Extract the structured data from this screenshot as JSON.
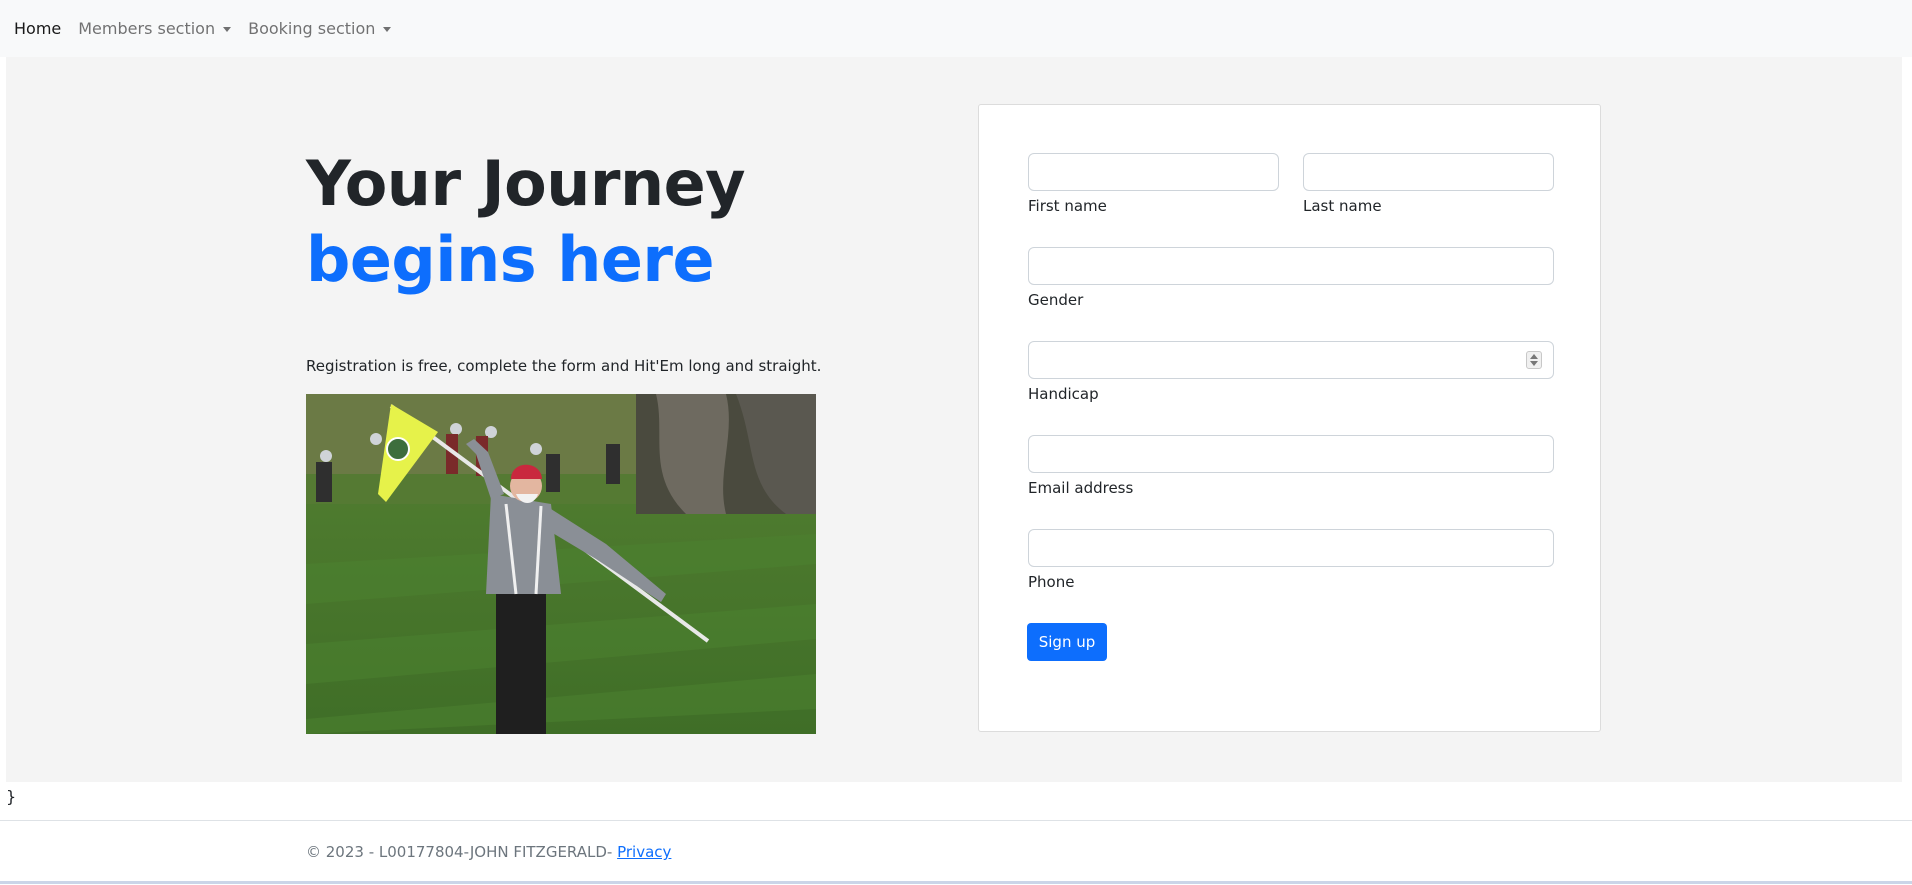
{
  "nav": {
    "home": "Home",
    "members": "Members section",
    "booking": "Booking section"
  },
  "hero": {
    "title_line1": "Your Journey",
    "title_line2": "begins here",
    "lead": "Registration is free, complete the form and Hit'Em long and straight.",
    "image_alt": "Golfer celebrating with a yellow flag on a green fairway"
  },
  "form": {
    "first_name_label": "First name",
    "first_name_value": "",
    "last_name_label": "Last name",
    "last_name_value": "",
    "gender_label": "Gender",
    "gender_value": "",
    "handicap_label": "Handicap",
    "handicap_value": "",
    "email_label": "Email address",
    "email_value": "",
    "phone_label": "Phone",
    "phone_value": "",
    "submit_label": "Sign up"
  },
  "stray_text": "}",
  "footer": {
    "copyright": "© 2023 - L00177804-JOHN FITZGERALD- ",
    "privacy_link": "Privacy"
  },
  "colors": {
    "accent": "#0d6efd",
    "section_bg": "#f4f4f4",
    "navbar_bg": "#f8f9fa"
  }
}
